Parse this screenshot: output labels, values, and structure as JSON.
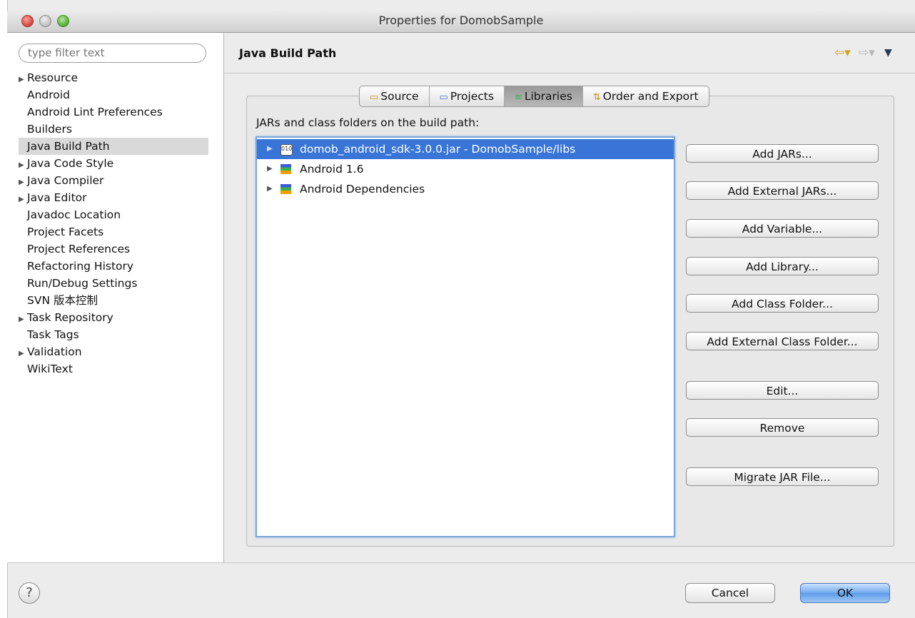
{
  "window": {
    "title": "Properties for DomobSample"
  },
  "sidebar": {
    "filter_placeholder": "type filter text",
    "items": [
      {
        "label": "Resource",
        "expandable": true
      },
      {
        "label": "Android",
        "expandable": false
      },
      {
        "label": "Android Lint Preferences",
        "expandable": false
      },
      {
        "label": "Builders",
        "expandable": false
      },
      {
        "label": "Java Build Path",
        "expandable": false,
        "selected": true
      },
      {
        "label": "Java Code Style",
        "expandable": true
      },
      {
        "label": "Java Compiler",
        "expandable": true
      },
      {
        "label": "Java Editor",
        "expandable": true
      },
      {
        "label": "Javadoc Location",
        "expandable": false
      },
      {
        "label": "Project Facets",
        "expandable": false
      },
      {
        "label": "Project References",
        "expandable": false
      },
      {
        "label": "Refactoring History",
        "expandable": false
      },
      {
        "label": "Run/Debug Settings",
        "expandable": false
      },
      {
        "label": "SVN 版本控制",
        "expandable": false
      },
      {
        "label": "Task Repository",
        "expandable": true
      },
      {
        "label": "Task Tags",
        "expandable": false
      },
      {
        "label": "Validation",
        "expandable": true
      },
      {
        "label": "WikiText",
        "expandable": false
      }
    ]
  },
  "page": {
    "title": "Java Build Path",
    "nav": {
      "back": "⇦▾",
      "forward": "⇨▾",
      "menu": "▼"
    }
  },
  "tabs": [
    {
      "label": "Source",
      "icon": "source-folder-icon"
    },
    {
      "label": "Projects",
      "icon": "projects-folder-icon"
    },
    {
      "label": "Libraries",
      "icon": "libraries-icon",
      "active": true
    },
    {
      "label": "Order and Export",
      "icon": "order-export-icon"
    }
  ],
  "libraries": {
    "list_label": "JARs and class folders on the build path:",
    "entries": [
      {
        "label": "domob_android_sdk-3.0.0.jar - DomobSample/libs",
        "icon": "jar-icon",
        "selected": true
      },
      {
        "label": "Android 1.6",
        "icon": "library-icon"
      },
      {
        "label": "Android Dependencies",
        "icon": "library-icon"
      }
    ],
    "buttons": {
      "add_jars": "Add JARs...",
      "add_external_jars": "Add External JARs...",
      "add_variable": "Add Variable...",
      "add_library": "Add Library...",
      "add_class_folder": "Add Class Folder...",
      "add_external_class_folder": "Add External Class Folder...",
      "edit": "Edit...",
      "remove": "Remove",
      "migrate_jar": "Migrate JAR File..."
    }
  },
  "footer": {
    "help": "?",
    "cancel": "Cancel",
    "ok": "OK"
  },
  "colors": {
    "selection": "#3875d7",
    "ok_button": "#6fa9ef"
  }
}
